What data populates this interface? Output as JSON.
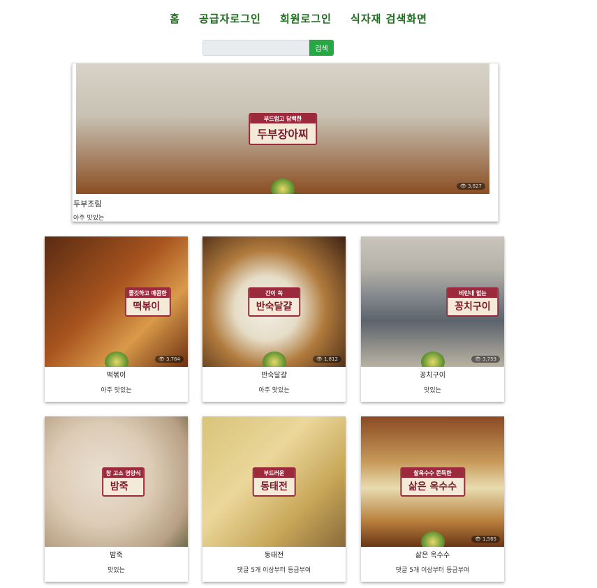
{
  "nav": {
    "items": [
      "홈",
      "공급자로그인",
      "회원로그인",
      "식자재 검색화면"
    ]
  },
  "search": {
    "placeholder": "",
    "button_label": "검색"
  },
  "featured": {
    "name": "두부조림",
    "desc": "아주 맛있는",
    "image": {
      "subtitle": "부드럽고 담백한",
      "title": "두부장아찌",
      "views": "3,827"
    }
  },
  "grid": [
    {
      "name": "떡볶이",
      "desc": "아주 맛있는",
      "image": {
        "subtitle": "쫄깃하고 매콤한",
        "title": "떡볶이",
        "views": "3,764"
      }
    },
    {
      "name": "반숙달걀",
      "desc": "아주 맛있는",
      "image": {
        "subtitle": "간이 쏙",
        "title": "반숙달걀",
        "views": "1,812"
      }
    },
    {
      "name": "꽁치구이",
      "desc": "맛있는",
      "image": {
        "subtitle": "비린내 없는",
        "title": "꽁치구이",
        "views": "3,759"
      }
    },
    {
      "name": "밤죽",
      "desc": "맛있는",
      "image": {
        "subtitle": "참 고소 영양식",
        "title": "밤죽",
        "views": ""
      }
    },
    {
      "name": "동태전",
      "desc": "댓글 5개 이상부터 등급부여",
      "image": {
        "subtitle": "부드러운",
        "title": "동태전",
        "views": ""
      }
    },
    {
      "name": "삶은 옥수수",
      "desc": "댓글 5개 이상부터 등급부여",
      "image": {
        "subtitle": "찰옥수수 쫀득한",
        "title": "삶은 옥수수",
        "views": "1,565"
      }
    }
  ],
  "colors": {
    "nav_text": "#1f6e1f",
    "search_button": "#28a745",
    "banner_border": "#9c2a3d"
  }
}
